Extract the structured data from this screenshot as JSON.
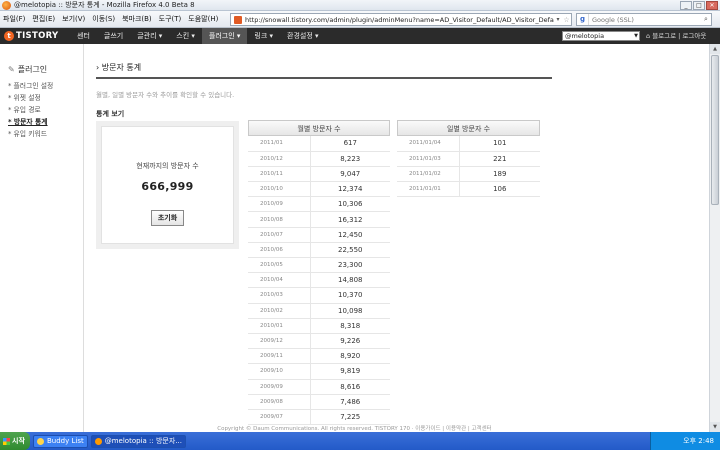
{
  "window": {
    "title": "@melotopia :: 방문자 통계 - Mozilla Firefox 4.0 Beta 8"
  },
  "menubar": [
    "파일(F)",
    "편집(E)",
    "보기(V)",
    "이동(S)",
    "북마크(B)",
    "도구(T)",
    "도움말(H)"
  ],
  "address": {
    "url": "http://snowall.tistory.com/admin/plugin/adminMenu?name=AD_Visitor_Default/AD_Visitor_Default"
  },
  "search": {
    "placeholder": "Google (SSL)"
  },
  "tistory": {
    "logo": "TISTORY",
    "menu": [
      "센터",
      "글쓰기",
      "글관리 ▾",
      "스킨 ▾",
      "플러그인 ▾",
      "링크 ▾",
      "환경설정 ▾"
    ],
    "blog_select": "@melotopia",
    "links": "⌂ 블로그로 | 로그아웃"
  },
  "sidebar": {
    "title": "플러그인",
    "items": [
      "* 플러그인 설정",
      "* 위젯 설정",
      "* 유입 경로",
      "* 방문자 통계",
      "* 유입 키워드"
    ],
    "active_index": 3
  },
  "main": {
    "title": "방문자 통계",
    "description": "월별, 일별 방문자 수와 추이를 확인할 수 있습니다.",
    "subtitle": "통계 보기",
    "total_label": "현재까지의 방문자 수",
    "total_value": "666,999",
    "reset_button": "초기화",
    "monthly_header": "월별 방문자 수",
    "monthly": [
      [
        "2011/01",
        "617"
      ],
      [
        "2010/12",
        "8,223"
      ],
      [
        "2010/11",
        "9,047"
      ],
      [
        "2010/10",
        "12,374"
      ],
      [
        "2010/09",
        "10,306"
      ],
      [
        "2010/08",
        "16,312"
      ],
      [
        "2010/07",
        "12,450"
      ],
      [
        "2010/06",
        "22,550"
      ],
      [
        "2010/05",
        "23,300"
      ],
      [
        "2010/04",
        "14,808"
      ],
      [
        "2010/03",
        "10,370"
      ],
      [
        "2010/02",
        "10,098"
      ],
      [
        "2010/01",
        "8,318"
      ],
      [
        "2009/12",
        "9,226"
      ],
      [
        "2009/11",
        "8,920"
      ],
      [
        "2009/10",
        "9,819"
      ],
      [
        "2009/09",
        "8,616"
      ],
      [
        "2009/08",
        "7,486"
      ],
      [
        "2009/07",
        "7,225"
      ]
    ],
    "daily_header": "일별 방문자 수",
    "daily": [
      [
        "2011/01/04",
        "101"
      ],
      [
        "2011/01/03",
        "221"
      ],
      [
        "2011/01/02",
        "189"
      ],
      [
        "2011/01/01",
        "106"
      ]
    ]
  },
  "footer": "Copyright © Daum Communications. All rights reserved. TISTORY 170 · 이용가이드 | 이용약관 | 고객센터",
  "taskbar": {
    "start": "시작",
    "tasks": [
      "Buddy List",
      "@melotopia :: 방문자..."
    ],
    "clock": "오후 2:48"
  }
}
